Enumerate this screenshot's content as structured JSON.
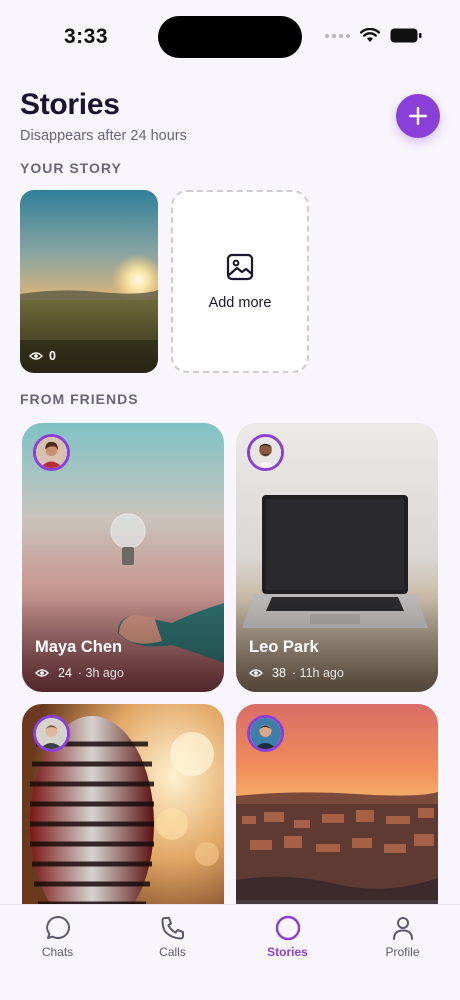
{
  "status_bar": {
    "time": "3:33"
  },
  "header": {
    "title": "Stories",
    "subtitle": "Disappears after 24 hours"
  },
  "sections": {
    "your_story": "YOUR STORY",
    "from_friends": "FROM FRIENDS"
  },
  "my_story": {
    "views": "0"
  },
  "add_more": {
    "label": "Add more"
  },
  "friends": [
    {
      "name": "Maya Chen",
      "views": "24",
      "ago": "· 3h ago"
    },
    {
      "name": "Leo Park",
      "views": "38",
      "ago": "· 11h ago"
    },
    {
      "name": "",
      "views": "",
      "ago": ""
    },
    {
      "name": "",
      "views": "",
      "ago": ""
    }
  ],
  "tabs": [
    {
      "label": "Chats",
      "icon": "chat-bubble-icon"
    },
    {
      "label": "Calls",
      "icon": "phone-icon"
    },
    {
      "label": "Stories",
      "icon": "circle-icon",
      "active": true
    },
    {
      "label": "Profile",
      "icon": "person-icon"
    }
  ],
  "colors": {
    "accent": "#8b3fd9",
    "background": "#f8f5fc"
  }
}
